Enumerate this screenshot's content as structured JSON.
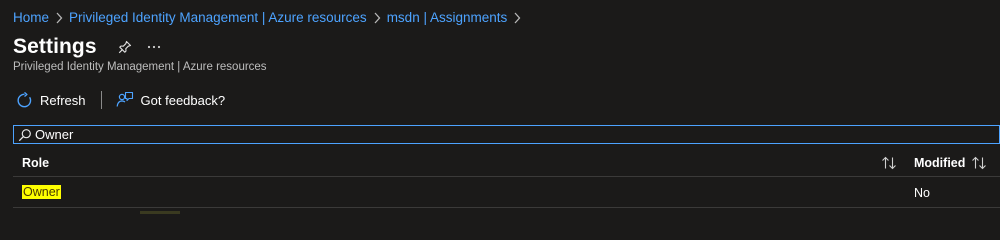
{
  "breadcrumb": {
    "items": [
      {
        "label": "Home"
      },
      {
        "label": "Privileged Identity Management | Azure resources"
      },
      {
        "label": "msdn | Assignments"
      }
    ]
  },
  "header": {
    "title": "Settings",
    "subtitle": "Privileged Identity Management | Azure resources",
    "icons": [
      "pin-icon",
      "more-icon"
    ]
  },
  "toolbar": {
    "refresh_label": "Refresh",
    "feedback_label": "Got feedback?",
    "icons": [
      "refresh-icon",
      "feedback-icon"
    ]
  },
  "search": {
    "value": "Owner",
    "placeholder": ""
  },
  "table": {
    "columns": [
      {
        "key": "role",
        "label": "Role"
      },
      {
        "key": "modified",
        "label": "Modified"
      }
    ],
    "rows": [
      {
        "role": "Owner",
        "modified": "No"
      }
    ]
  },
  "colors": {
    "background": "#1b1a19",
    "link": "#4da3ff",
    "highlight": "#ffff00",
    "divider": "#3b3a39"
  }
}
